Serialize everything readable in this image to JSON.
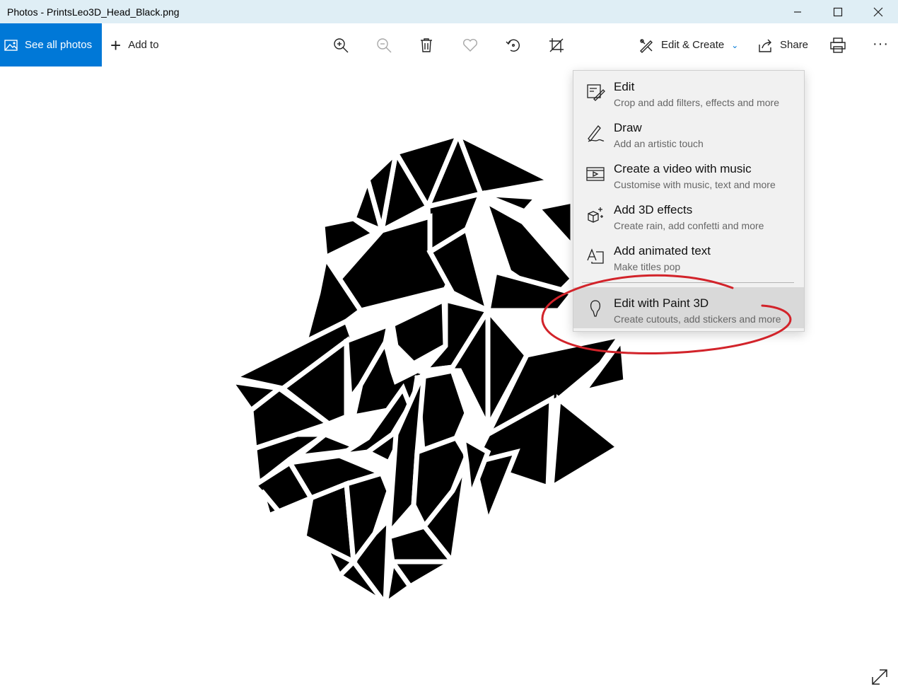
{
  "window": {
    "title": "Photos - PrintsLeo3D_Head_Black.png"
  },
  "toolbar": {
    "see_all_label": "See all photos",
    "add_to_label": "Add to",
    "edit_create_label": "Edit & Create",
    "share_label": "Share",
    "more_label": "···"
  },
  "icons": {
    "zoom_in": "zoom-in-icon",
    "zoom_out": "zoom-out-icon",
    "delete": "trash-icon",
    "favorite": "heart-icon",
    "rotate": "rotate-icon",
    "crop": "crop-icon",
    "print": "printer-icon",
    "expand": "expand-icon"
  },
  "menu": {
    "items": [
      {
        "label": "Edit",
        "desc": "Crop and add filters, effects and more",
        "icon": "edit-photo-icon"
      },
      {
        "label": "Draw",
        "desc": "Add an artistic touch",
        "icon": "pen-icon"
      },
      {
        "label": "Create a video with music",
        "desc": "Customise with music, text and more",
        "icon": "video-icon"
      },
      {
        "label": "Add 3D effects",
        "desc": "Create rain, add confetti and more",
        "icon": "3d-effects-icon"
      },
      {
        "label": "Add animated text",
        "desc": "Make titles pop",
        "icon": "animated-text-icon"
      },
      {
        "label": "Edit with Paint 3D",
        "desc": "Create cutouts, add stickers and more",
        "icon": "paint3d-icon"
      }
    ]
  },
  "colors": {
    "accent": "#0078d7",
    "annotation": "#d2232a"
  }
}
